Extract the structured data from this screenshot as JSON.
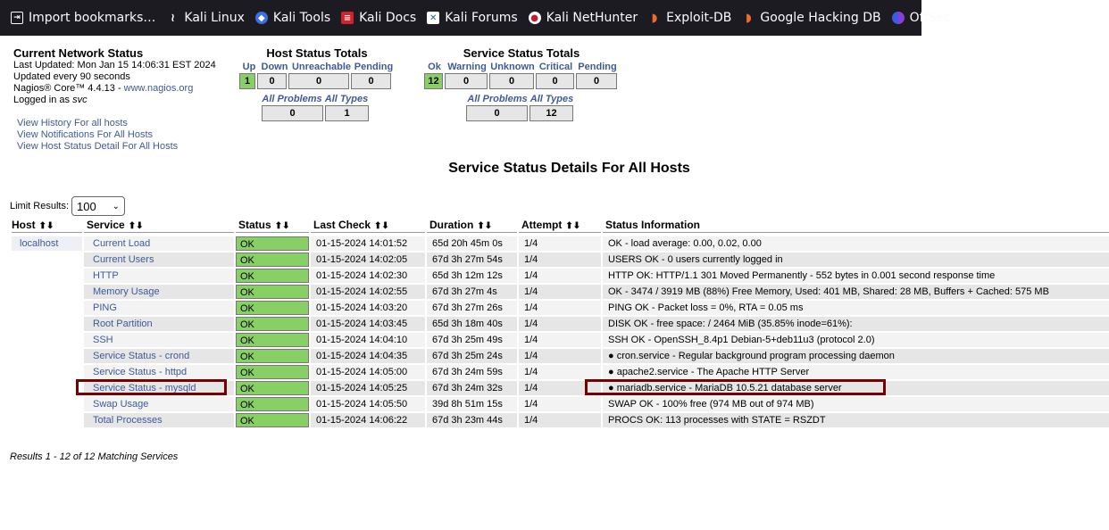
{
  "bookmarks": [
    {
      "label": "Import bookmarks…",
      "icon": "import-icon"
    },
    {
      "label": "Kali Linux",
      "icon": "kali-dragon-icon"
    },
    {
      "label": "Kali Tools",
      "icon": "kali-tools-icon"
    },
    {
      "label": "Kali Docs",
      "icon": "kali-docs-icon"
    },
    {
      "label": "Kali Forums",
      "icon": "kali-forums-icon"
    },
    {
      "label": "Kali NetHunter",
      "icon": "kali-nethunter-icon"
    },
    {
      "label": "Exploit-DB",
      "icon": "exploit-db-icon"
    },
    {
      "label": "Google Hacking DB",
      "icon": "ghdb-icon"
    },
    {
      "label": "OffSec",
      "icon": "offsec-icon"
    }
  ],
  "info": {
    "title": "Current Network Status",
    "last_updated": "Last Updated: Mon Jan 15 14:06:31 EST 2024",
    "update_every": "Updated every 90 seconds",
    "version_prefix": "Nagios® Core™ 4.4.13 - ",
    "version_link": "www.nagios.org",
    "logged_in_prefix": "Logged in as ",
    "user": "svc"
  },
  "links": [
    "View History For all hosts",
    "View Notifications For All Hosts",
    "View Host Status Detail For All Hosts"
  ],
  "host_totals": {
    "title": "Host Status Totals",
    "headers": [
      "Up",
      "Down",
      "Unreachable",
      "Pending"
    ],
    "values": [
      "1",
      "0",
      "0",
      "0"
    ],
    "ap_headers": [
      "All Problems",
      "All Types"
    ],
    "ap_values": [
      "0",
      "1"
    ]
  },
  "service_totals": {
    "title": "Service Status Totals",
    "headers": [
      "Ok",
      "Warning",
      "Unknown",
      "Critical",
      "Pending"
    ],
    "values": [
      "12",
      "0",
      "0",
      "0",
      "0"
    ],
    "ap_headers": [
      "All Problems",
      "All Types"
    ],
    "ap_values": [
      "0",
      "12"
    ]
  },
  "main_title": "Service Status Details For All Hosts",
  "limit": {
    "label": "Limit Results:",
    "value": "100"
  },
  "columns": [
    "Host",
    "Service",
    "Status",
    "Last Check",
    "Duration",
    "Attempt",
    "Status Information"
  ],
  "host": "localhost",
  "rows": [
    {
      "service": "Current Load",
      "status": "OK",
      "last_check": "01-15-2024 14:01:52",
      "duration": "65d 20h 45m 0s",
      "attempt": "1/4",
      "info": "OK - load average: 0.00, 0.02, 0.00"
    },
    {
      "service": "Current Users",
      "status": "OK",
      "last_check": "01-15-2024 14:02:05",
      "duration": "67d 3h 27m 54s",
      "attempt": "1/4",
      "info": "USERS OK - 0 users currently logged in"
    },
    {
      "service": "HTTP",
      "status": "OK",
      "last_check": "01-15-2024 14:02:30",
      "duration": "65d 3h 12m 12s",
      "attempt": "1/4",
      "info": "HTTP OK: HTTP/1.1 301 Moved Permanently - 552 bytes in 0.001 second response time"
    },
    {
      "service": "Memory Usage",
      "status": "OK",
      "last_check": "01-15-2024 14:02:55",
      "duration": "67d 3h 27m 4s",
      "attempt": "1/4",
      "info": "OK - 3474 / 3919 MB (88%) Free Memory, Used: 401 MB, Shared: 28 MB, Buffers + Cached: 575 MB"
    },
    {
      "service": "PING",
      "status": "OK",
      "last_check": "01-15-2024 14:03:20",
      "duration": "67d 3h 27m 26s",
      "attempt": "1/4",
      "info": "PING OK - Packet loss = 0%, RTA = 0.05 ms"
    },
    {
      "service": "Root Partition",
      "status": "OK",
      "last_check": "01-15-2024 14:03:45",
      "duration": "65d 3h 18m 40s",
      "attempt": "1/4",
      "info": "DISK OK - free space: / 2464 MiB (35.85% inode=61%):"
    },
    {
      "service": "SSH",
      "status": "OK",
      "last_check": "01-15-2024 14:04:10",
      "duration": "67d 3h 25m 49s",
      "attempt": "1/4",
      "info": "SSH OK - OpenSSH_8.4p1 Debian-5+deb11u3 (protocol 2.0)"
    },
    {
      "service": "Service Status - crond",
      "status": "OK",
      "last_check": "01-15-2024 14:04:35",
      "duration": "67d 3h 25m 24s",
      "attempt": "1/4",
      "info": "● cron.service - Regular background program processing daemon"
    },
    {
      "service": "Service Status - httpd",
      "status": "OK",
      "last_check": "01-15-2024 14:05:00",
      "duration": "67d 3h 24m 59s",
      "attempt": "1/4",
      "info": "● apache2.service - The Apache HTTP Server"
    },
    {
      "service": "Service Status - mysqld",
      "status": "OK",
      "last_check": "01-15-2024 14:05:25",
      "duration": "67d 3h 24m 32s",
      "attempt": "1/4",
      "info": "● mariadb.service - MariaDB 10.5.21 database server"
    },
    {
      "service": "Swap Usage",
      "status": "OK",
      "last_check": "01-15-2024 14:05:50",
      "duration": "39d 8h 51m 15s",
      "attempt": "1/4",
      "info": "SWAP OK - 100% free (974 MB out of 974 MB)"
    },
    {
      "service": "Total Processes",
      "status": "OK",
      "last_check": "01-15-2024 14:06:22",
      "duration": "67d 3h 23m 44s",
      "attempt": "1/4",
      "info": "PROCS OK: 113 processes with STATE = RSZDT"
    }
  ],
  "results_text": "Results 1 - 12 of 12 Matching Services",
  "colors": {
    "ok_green": "#88d066",
    "link_blue": "#3f5a97",
    "highlight": "#7a0000"
  }
}
